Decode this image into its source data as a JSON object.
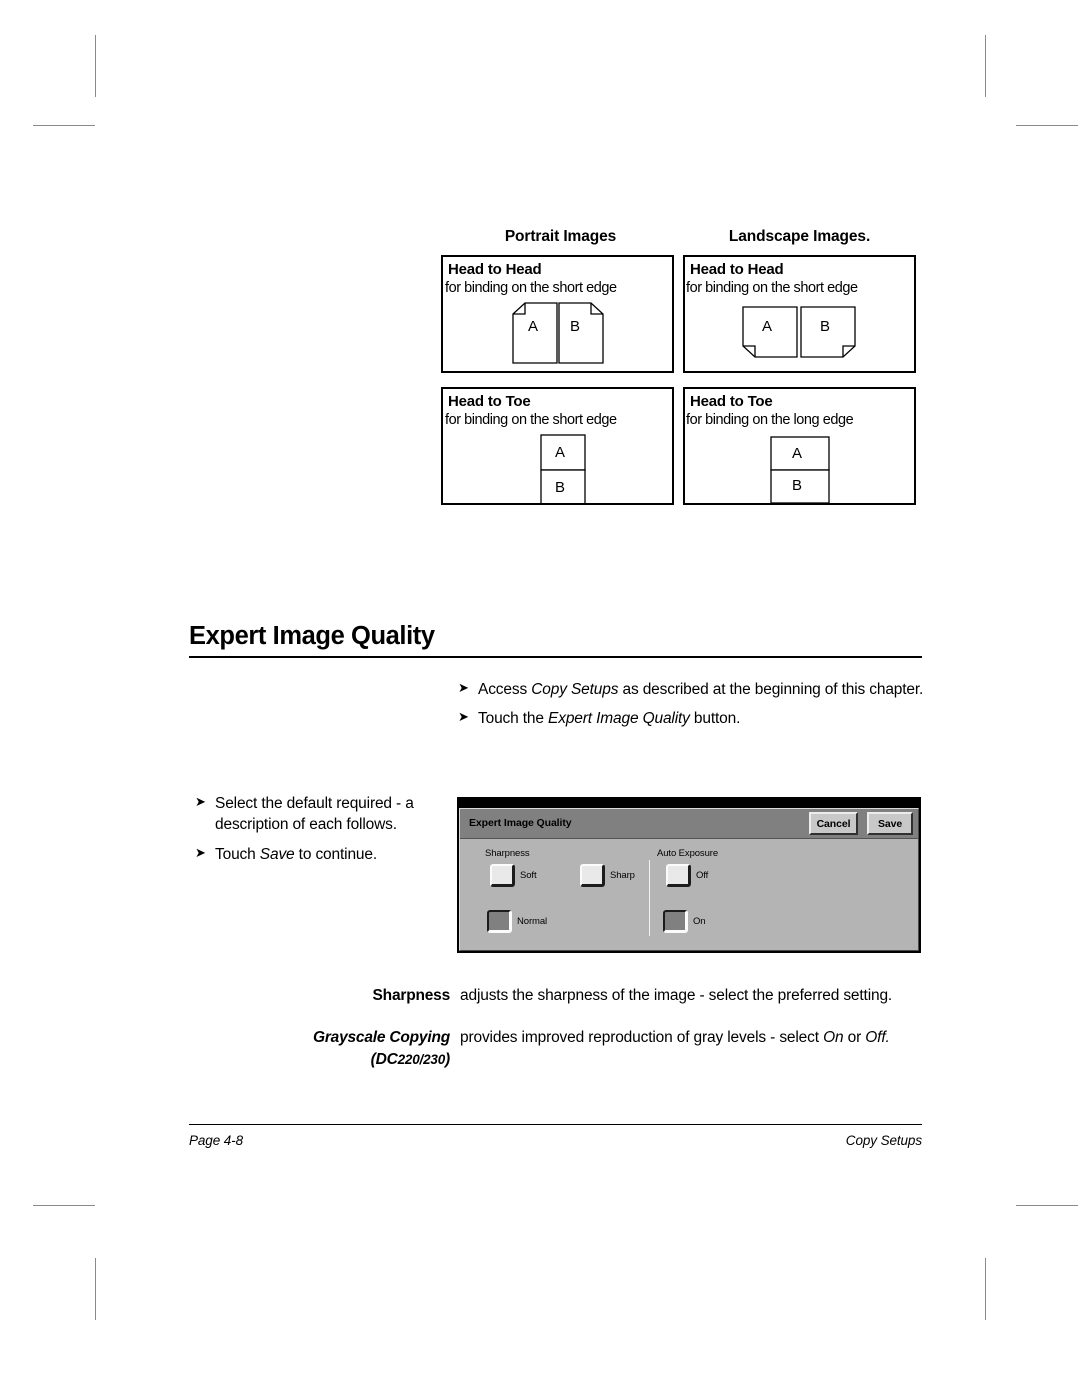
{
  "diagrams": {
    "column_headers": [
      "Portrait Images",
      "Landscape Images."
    ],
    "boxes": [
      {
        "title": "Head to Head",
        "subtitle": "for binding on the short edge",
        "orientation": "portrait",
        "layout": "head-to-head",
        "page_labels": [
          "A",
          "B"
        ]
      },
      {
        "title": "Head to Head",
        "subtitle": "for binding on the short edge",
        "orientation": "landscape",
        "layout": "head-to-head",
        "page_labels": [
          "A",
          "B"
        ]
      },
      {
        "title": "Head to Toe",
        "subtitle": "for binding on the short edge",
        "orientation": "portrait",
        "layout": "head-to-toe",
        "page_labels": [
          "A",
          "B"
        ]
      },
      {
        "title": "Head to Toe",
        "subtitle": "for binding on the long edge",
        "orientation": "landscape",
        "layout": "head-to-toe",
        "page_labels": [
          "A",
          "B"
        ]
      }
    ]
  },
  "section": {
    "heading": "Expert Image Quality"
  },
  "steps_top": [
    {
      "bullet": "➢",
      "parts": [
        {
          "text": "Access ",
          "style": "normal"
        },
        {
          "text": "Copy Setups",
          "style": "italic"
        },
        {
          "text": " as described at the beginning of this chapter.",
          "style": "normal"
        }
      ]
    },
    {
      "bullet": "➢",
      "parts": [
        {
          "text": "Touch the ",
          "style": "normal"
        },
        {
          "text": "Expert Image Quality",
          "style": "italic"
        },
        {
          "text": " button.",
          "style": "normal"
        }
      ]
    }
  ],
  "steps_left": [
    {
      "bullet": "➢",
      "parts": [
        {
          "text": "Select the default required - a description of each follows.",
          "style": "normal"
        }
      ]
    },
    {
      "bullet": "➢",
      "parts": [
        {
          "text": "Touch ",
          "style": "normal"
        },
        {
          "text": "Save",
          "style": "italic"
        },
        {
          "text": " to continue.",
          "style": "normal"
        }
      ]
    }
  ],
  "ui_screenshot": {
    "title": "Expert Image Quality",
    "cancel_label": "Cancel",
    "save_label": "Save",
    "groups": [
      {
        "label": "Sharpness",
        "options": [
          {
            "label": "Soft",
            "selected": false
          },
          {
            "label": "Sharp",
            "selected": false
          },
          {
            "label": "Normal",
            "selected": true
          }
        ]
      },
      {
        "label": "Auto Exposure",
        "options": [
          {
            "label": "Off",
            "selected": false
          },
          {
            "label": "On",
            "selected": true
          }
        ]
      }
    ]
  },
  "definitions": [
    {
      "term": "Sharpness",
      "term_suffix": "",
      "desc_plain": "adjusts the sharpness of the image - select the preferred setting."
    },
    {
      "term": "Grayscale Copying",
      "term_suffix": "(DC220/230)",
      "desc_plain": "provides improved reproduction of gray levels - select On or Off."
    }
  ],
  "footer": {
    "page_label": "Page 4-8",
    "section_label": "Copy Setups"
  }
}
